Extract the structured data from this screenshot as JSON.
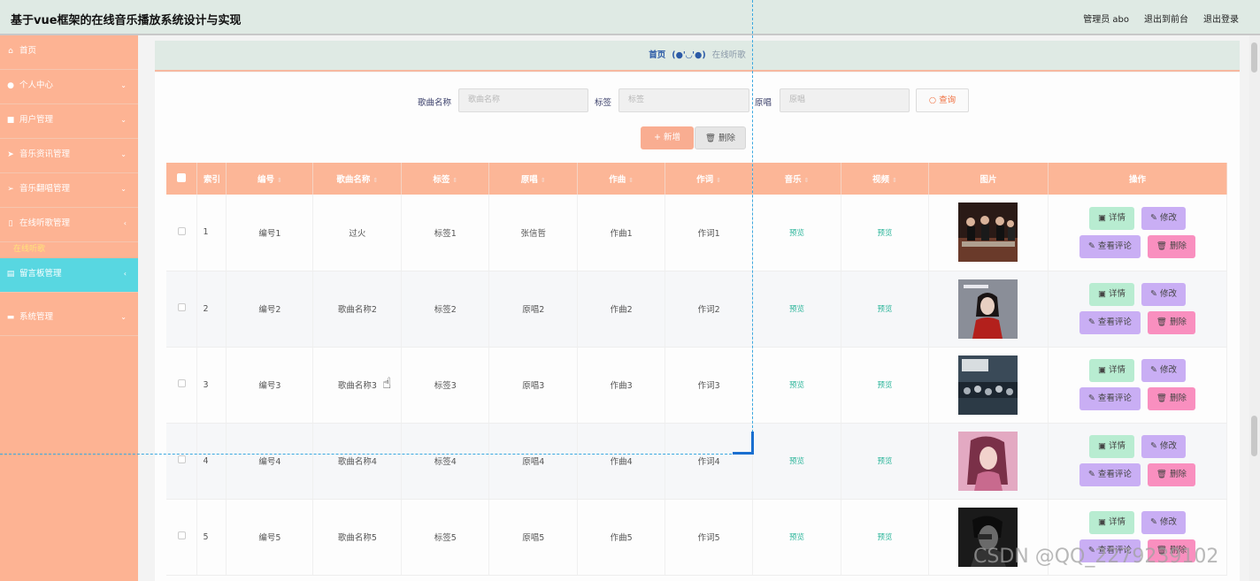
{
  "app": {
    "title": "基于vue框架的在线音乐播放系统设计与实现",
    "admin_label": "管理员 abo",
    "to_front_label": "退出到前台",
    "logout_label": "退出登录"
  },
  "sidebar": {
    "items": [
      {
        "label": "首页",
        "icon": "home-icon"
      },
      {
        "label": "个人中心",
        "icon": "user-icon"
      },
      {
        "label": "用户管理",
        "icon": "camera-icon"
      },
      {
        "label": "音乐资讯管理",
        "icon": "send-icon"
      },
      {
        "label": "音乐翻唱管理",
        "icon": "send-icon"
      },
      {
        "label": "在线听歌管理",
        "icon": "mic-icon"
      },
      {
        "label": "留言板管理",
        "icon": "trash-icon"
      },
      {
        "label": "系统管理",
        "icon": "briefcase-icon"
      }
    ],
    "submenu": {
      "label": "在线听歌"
    }
  },
  "breadcrumb": {
    "home": "首页",
    "face": "(●'◡'●)",
    "current": "在线听歌"
  },
  "search": {
    "song_label": "歌曲名称",
    "song_placeholder": "歌曲名称",
    "tag_label": "标签",
    "tag_placeholder": "标签",
    "singer_label": "原唱",
    "singer_placeholder": "原唱",
    "query_label": "查询"
  },
  "actions": {
    "add_label": "新增",
    "delete_label": "删除"
  },
  "table": {
    "columns": [
      "索引",
      "编号",
      "歌曲名称",
      "标签",
      "原唱",
      "作曲",
      "作词",
      "音乐",
      "视频",
      "图片",
      "操作"
    ],
    "preview_label": "预览",
    "ops": {
      "detail": "详情",
      "edit": "修改",
      "comments": "查看评论",
      "remove": "删除"
    },
    "rows": [
      {
        "index": "1",
        "code": "编号1",
        "name": "过火",
        "tag": "标签1",
        "singer": "张信哲",
        "composer": "作曲1",
        "lyricist": "作词1",
        "image": "band-photo"
      },
      {
        "index": "2",
        "code": "编号2",
        "name": "歌曲名称2",
        "tag": "标签2",
        "singer": "原唱2",
        "composer": "作曲2",
        "lyricist": "作词2",
        "image": "album-cover-girl"
      },
      {
        "index": "3",
        "code": "编号3",
        "name": "歌曲名称3",
        "tag": "标签3",
        "singer": "原唱3",
        "composer": "作曲3",
        "lyricist": "作词3",
        "image": "crowd-poster"
      },
      {
        "index": "4",
        "code": "编号4",
        "name": "歌曲名称4",
        "tag": "标签4",
        "singer": "原唱4",
        "composer": "作曲4",
        "lyricist": "作词4",
        "image": "singer-portrait"
      },
      {
        "index": "5",
        "code": "编号5",
        "name": "歌曲名称5",
        "tag": "标签5",
        "singer": "原唱5",
        "composer": "作曲5",
        "lyricist": "作词5",
        "image": "dark-portrait"
      }
    ]
  },
  "watermark": "CSDN @QQ_2279239102"
}
